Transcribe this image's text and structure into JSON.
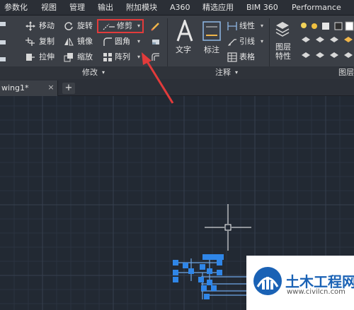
{
  "ribbon_tabs": [
    "参数化",
    "视图",
    "管理",
    "输出",
    "附加模块",
    "A360",
    "精选应用",
    "BIM 360",
    "Performance"
  ],
  "modify_tools": {
    "move": "移动",
    "rotate": "旋转",
    "trim": "修剪",
    "copy": "复制",
    "mirror": "镜像",
    "fillet": "圆角",
    "stretch": "拉伸",
    "scale": "缩放",
    "array": "阵列"
  },
  "annotation_tools": {
    "text": "文字",
    "dimension": "标注",
    "linear": "线性",
    "leader": "引线",
    "table": "表格"
  },
  "layer_tools": {
    "layer_properties": "图层\n特性"
  },
  "panel_titles": {
    "modify": "修改",
    "annotation": "注释",
    "layers": "图层"
  },
  "document_tab": {
    "label": "wing1*",
    "close": "×",
    "add": "+"
  },
  "watermark": {
    "title": "土木工程网",
    "url": "www.civilcn.com"
  },
  "colors": {
    "accent_red": "#e23b3b",
    "selection_blue": "#2f86e8"
  }
}
